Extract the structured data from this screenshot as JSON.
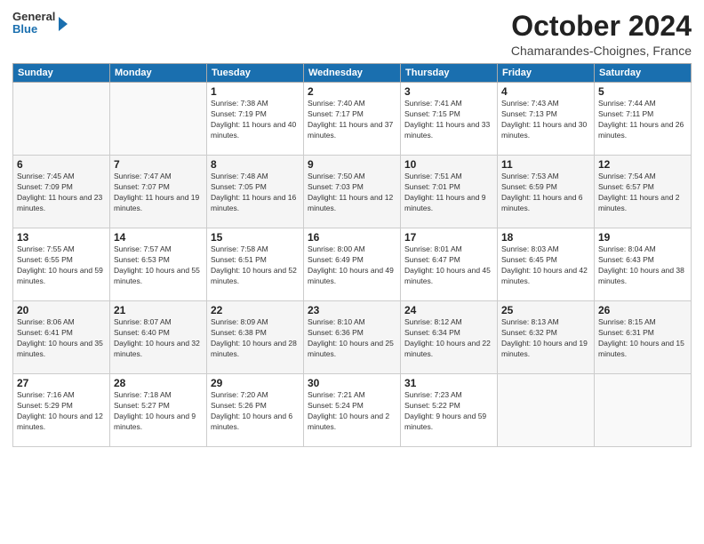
{
  "logo": {
    "general": "General",
    "blue": "Blue"
  },
  "title": "October 2024",
  "location": "Chamarandes-Choignes, France",
  "days_of_week": [
    "Sunday",
    "Monday",
    "Tuesday",
    "Wednesday",
    "Thursday",
    "Friday",
    "Saturday"
  ],
  "weeks": [
    [
      {
        "day": "",
        "info": ""
      },
      {
        "day": "",
        "info": ""
      },
      {
        "day": "1",
        "info": "Sunrise: 7:38 AM\nSunset: 7:19 PM\nDaylight: 11 hours and 40 minutes."
      },
      {
        "day": "2",
        "info": "Sunrise: 7:40 AM\nSunset: 7:17 PM\nDaylight: 11 hours and 37 minutes."
      },
      {
        "day": "3",
        "info": "Sunrise: 7:41 AM\nSunset: 7:15 PM\nDaylight: 11 hours and 33 minutes."
      },
      {
        "day": "4",
        "info": "Sunrise: 7:43 AM\nSunset: 7:13 PM\nDaylight: 11 hours and 30 minutes."
      },
      {
        "day": "5",
        "info": "Sunrise: 7:44 AM\nSunset: 7:11 PM\nDaylight: 11 hours and 26 minutes."
      }
    ],
    [
      {
        "day": "6",
        "info": "Sunrise: 7:45 AM\nSunset: 7:09 PM\nDaylight: 11 hours and 23 minutes."
      },
      {
        "day": "7",
        "info": "Sunrise: 7:47 AM\nSunset: 7:07 PM\nDaylight: 11 hours and 19 minutes."
      },
      {
        "day": "8",
        "info": "Sunrise: 7:48 AM\nSunset: 7:05 PM\nDaylight: 11 hours and 16 minutes."
      },
      {
        "day": "9",
        "info": "Sunrise: 7:50 AM\nSunset: 7:03 PM\nDaylight: 11 hours and 12 minutes."
      },
      {
        "day": "10",
        "info": "Sunrise: 7:51 AM\nSunset: 7:01 PM\nDaylight: 11 hours and 9 minutes."
      },
      {
        "day": "11",
        "info": "Sunrise: 7:53 AM\nSunset: 6:59 PM\nDaylight: 11 hours and 6 minutes."
      },
      {
        "day": "12",
        "info": "Sunrise: 7:54 AM\nSunset: 6:57 PM\nDaylight: 11 hours and 2 minutes."
      }
    ],
    [
      {
        "day": "13",
        "info": "Sunrise: 7:55 AM\nSunset: 6:55 PM\nDaylight: 10 hours and 59 minutes."
      },
      {
        "day": "14",
        "info": "Sunrise: 7:57 AM\nSunset: 6:53 PM\nDaylight: 10 hours and 55 minutes."
      },
      {
        "day": "15",
        "info": "Sunrise: 7:58 AM\nSunset: 6:51 PM\nDaylight: 10 hours and 52 minutes."
      },
      {
        "day": "16",
        "info": "Sunrise: 8:00 AM\nSunset: 6:49 PM\nDaylight: 10 hours and 49 minutes."
      },
      {
        "day": "17",
        "info": "Sunrise: 8:01 AM\nSunset: 6:47 PM\nDaylight: 10 hours and 45 minutes."
      },
      {
        "day": "18",
        "info": "Sunrise: 8:03 AM\nSunset: 6:45 PM\nDaylight: 10 hours and 42 minutes."
      },
      {
        "day": "19",
        "info": "Sunrise: 8:04 AM\nSunset: 6:43 PM\nDaylight: 10 hours and 38 minutes."
      }
    ],
    [
      {
        "day": "20",
        "info": "Sunrise: 8:06 AM\nSunset: 6:41 PM\nDaylight: 10 hours and 35 minutes."
      },
      {
        "day": "21",
        "info": "Sunrise: 8:07 AM\nSunset: 6:40 PM\nDaylight: 10 hours and 32 minutes."
      },
      {
        "day": "22",
        "info": "Sunrise: 8:09 AM\nSunset: 6:38 PM\nDaylight: 10 hours and 28 minutes."
      },
      {
        "day": "23",
        "info": "Sunrise: 8:10 AM\nSunset: 6:36 PM\nDaylight: 10 hours and 25 minutes."
      },
      {
        "day": "24",
        "info": "Sunrise: 8:12 AM\nSunset: 6:34 PM\nDaylight: 10 hours and 22 minutes."
      },
      {
        "day": "25",
        "info": "Sunrise: 8:13 AM\nSunset: 6:32 PM\nDaylight: 10 hours and 19 minutes."
      },
      {
        "day": "26",
        "info": "Sunrise: 8:15 AM\nSunset: 6:31 PM\nDaylight: 10 hours and 15 minutes."
      }
    ],
    [
      {
        "day": "27",
        "info": "Sunrise: 7:16 AM\nSunset: 5:29 PM\nDaylight: 10 hours and 12 minutes."
      },
      {
        "day": "28",
        "info": "Sunrise: 7:18 AM\nSunset: 5:27 PM\nDaylight: 10 hours and 9 minutes."
      },
      {
        "day": "29",
        "info": "Sunrise: 7:20 AM\nSunset: 5:26 PM\nDaylight: 10 hours and 6 minutes."
      },
      {
        "day": "30",
        "info": "Sunrise: 7:21 AM\nSunset: 5:24 PM\nDaylight: 10 hours and 2 minutes."
      },
      {
        "day": "31",
        "info": "Sunrise: 7:23 AM\nSunset: 5:22 PM\nDaylight: 9 hours and 59 minutes."
      },
      {
        "day": "",
        "info": ""
      },
      {
        "day": "",
        "info": ""
      }
    ]
  ]
}
